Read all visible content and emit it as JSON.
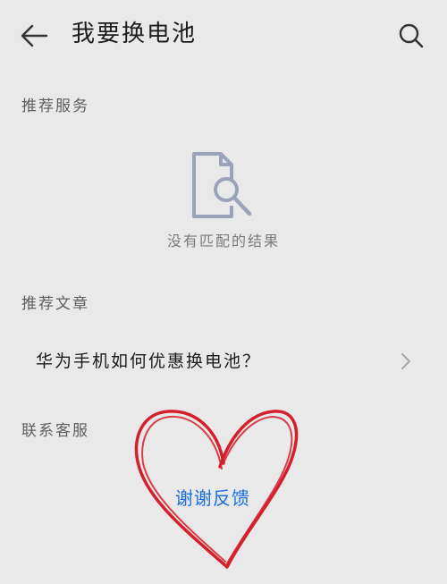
{
  "header": {
    "title": "我要换电池",
    "back_icon": "arrow-left-icon",
    "search_icon": "search-icon"
  },
  "sections": {
    "recommended_services": {
      "label": "推荐服务",
      "empty_icon": "document-search-icon",
      "empty_text": "没有匹配的结果"
    },
    "recommended_articles": {
      "label": "推荐文章",
      "items": [
        {
          "title": "华为手机如何优惠换电池？",
          "icon": "chevron-right-icon"
        }
      ]
    },
    "contact_support": {
      "label": "联系客服",
      "link_label": "谢谢反馈",
      "decoration": "red-heart-drawing"
    }
  },
  "colors": {
    "background": "#e9e9e9",
    "link": "#1a6fe0",
    "heart": "#d4202c",
    "icon": "#9aa3b8"
  }
}
